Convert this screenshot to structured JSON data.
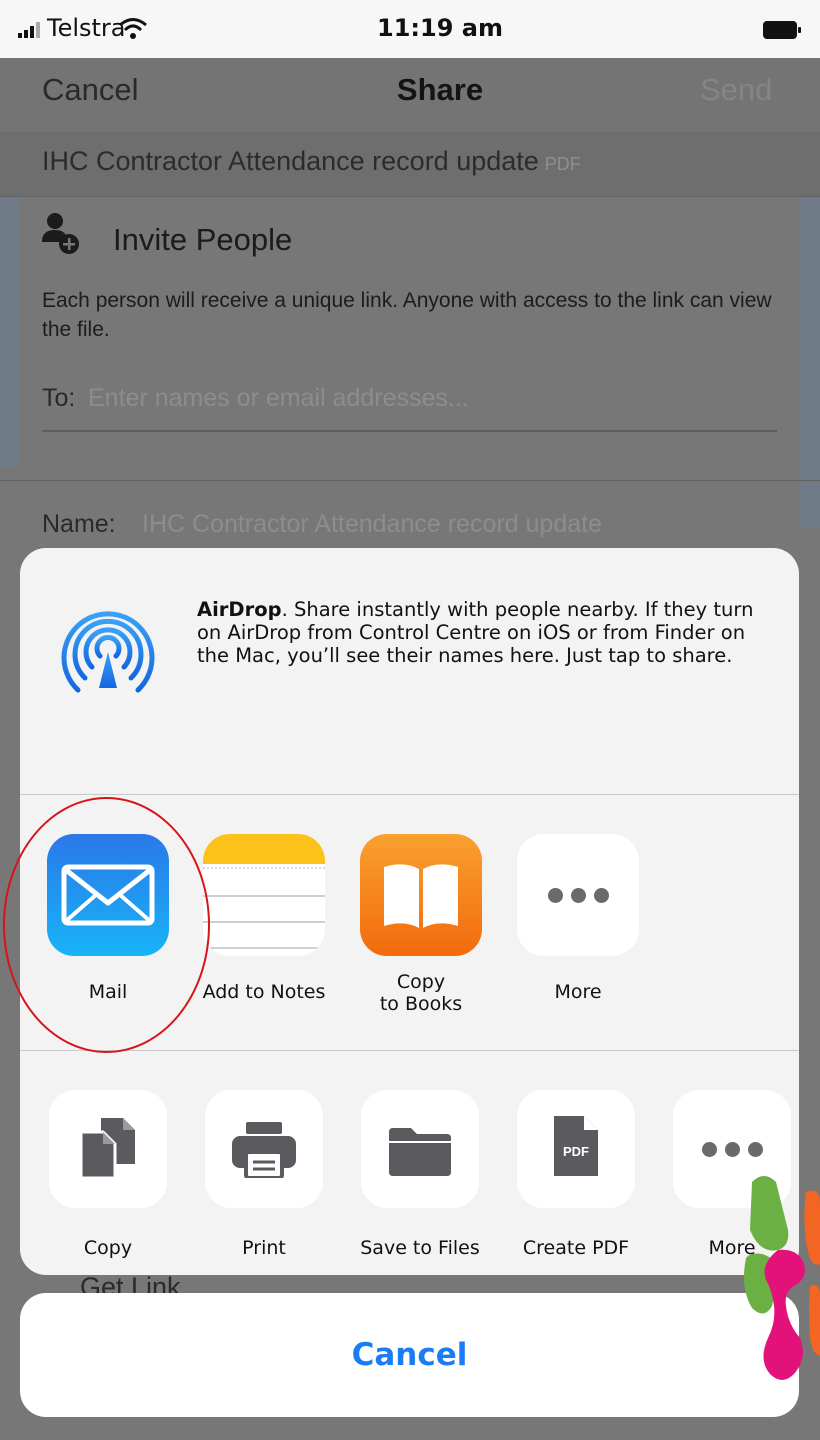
{
  "status_bar": {
    "carrier": "Telstra",
    "time": "11:19 am"
  },
  "nav": {
    "cancel": "Cancel",
    "title": "Share",
    "send": "Send"
  },
  "document": {
    "title": "IHC Contractor Attendance record update",
    "type": "PDF"
  },
  "invite": {
    "title": "Invite People",
    "description": "Each person will receive a unique link. Anyone with access to the link can view the file.",
    "to_label": "To:",
    "to_placeholder": "Enter names or email addresses..."
  },
  "name_field": {
    "label": "Name:",
    "value": "IHC Contractor Attendance record update"
  },
  "get_link": {
    "label": "Get Link"
  },
  "share_sheet": {
    "airdrop": {
      "title": "AirDrop",
      "text": ". Share instantly with people nearby. If they turn on AirDrop from Control Centre on iOS or from Finder on the Mac, you’ll see their names here. Just tap to share."
    },
    "apps": [
      {
        "label": "Mail",
        "icon": "mail-icon"
      },
      {
        "label": "Add to Notes",
        "icon": "notes-icon"
      },
      {
        "label": "Copy\nto Books",
        "icon": "books-icon"
      },
      {
        "label": "More",
        "icon": "more-icon"
      }
    ],
    "actions": [
      {
        "label": "Copy",
        "icon": "copy-icon"
      },
      {
        "label": "Print",
        "icon": "print-icon"
      },
      {
        "label": "Save to Files",
        "icon": "folder-icon"
      },
      {
        "label": "Create PDF",
        "icon": "pdf-icon",
        "icon_text": "PDF"
      },
      {
        "label": "More",
        "icon": "more-icon"
      }
    ],
    "cancel": "Cancel"
  },
  "colors": {
    "accent": "#1a7cf5",
    "highlight": "#d8141b",
    "books_orange": "#f7891a",
    "mail_blue": "#1e8ff0"
  }
}
